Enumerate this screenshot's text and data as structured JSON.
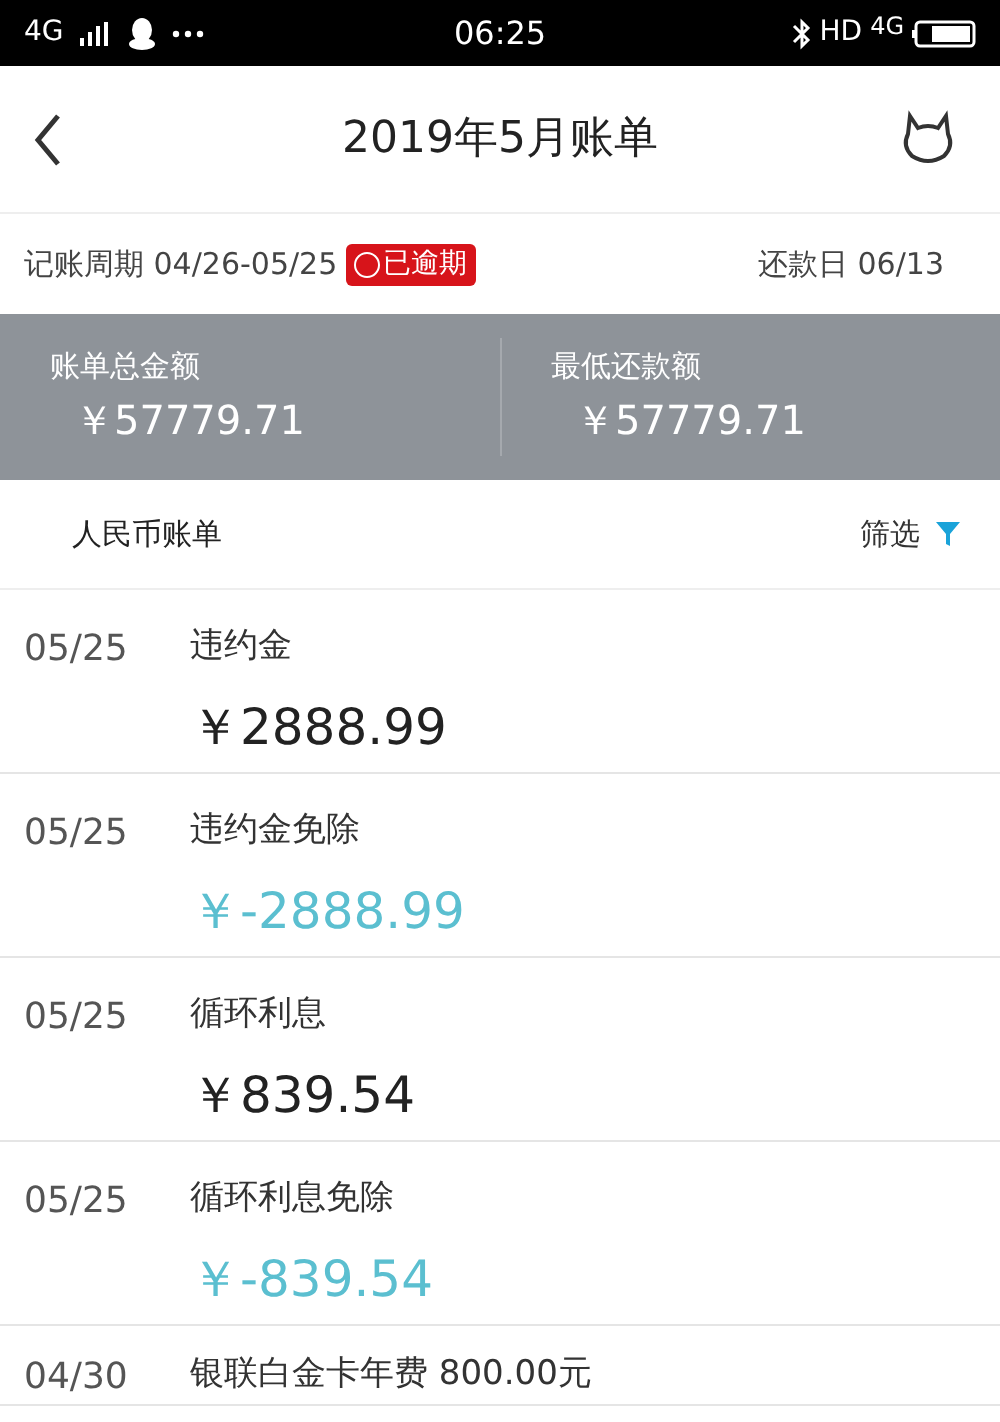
{
  "status_bar": {
    "network": "4G",
    "time": "06:25",
    "hd": "HD",
    "network_right": "4G"
  },
  "nav": {
    "title": "2019年5月账单"
  },
  "period": {
    "label": "记账周期 04/26-05/25",
    "badge": "已逾期",
    "due": "还款日 06/13"
  },
  "summary": [
    {
      "label": "账单总金额",
      "amount": "￥57779.71"
    },
    {
      "label": "最低还款额",
      "amount": "￥57779.71"
    }
  ],
  "section": {
    "title": "人民币账单",
    "filter": "筛选"
  },
  "transactions": [
    {
      "date": "05/25",
      "name": "违约金",
      "amount": "￥2888.99",
      "kind": "charge"
    },
    {
      "date": "05/25",
      "name": "违约金免除",
      "amount": "￥-2888.99",
      "kind": "waiver"
    },
    {
      "date": "05/25",
      "name": "循环利息",
      "amount": "￥839.54",
      "kind": "charge"
    },
    {
      "date": "05/25",
      "name": "循环利息免除",
      "amount": "￥-839.54",
      "kind": "waiver"
    },
    {
      "date": "04/30",
      "name": "银联白金卡年费 800.00元"
    }
  ]
}
